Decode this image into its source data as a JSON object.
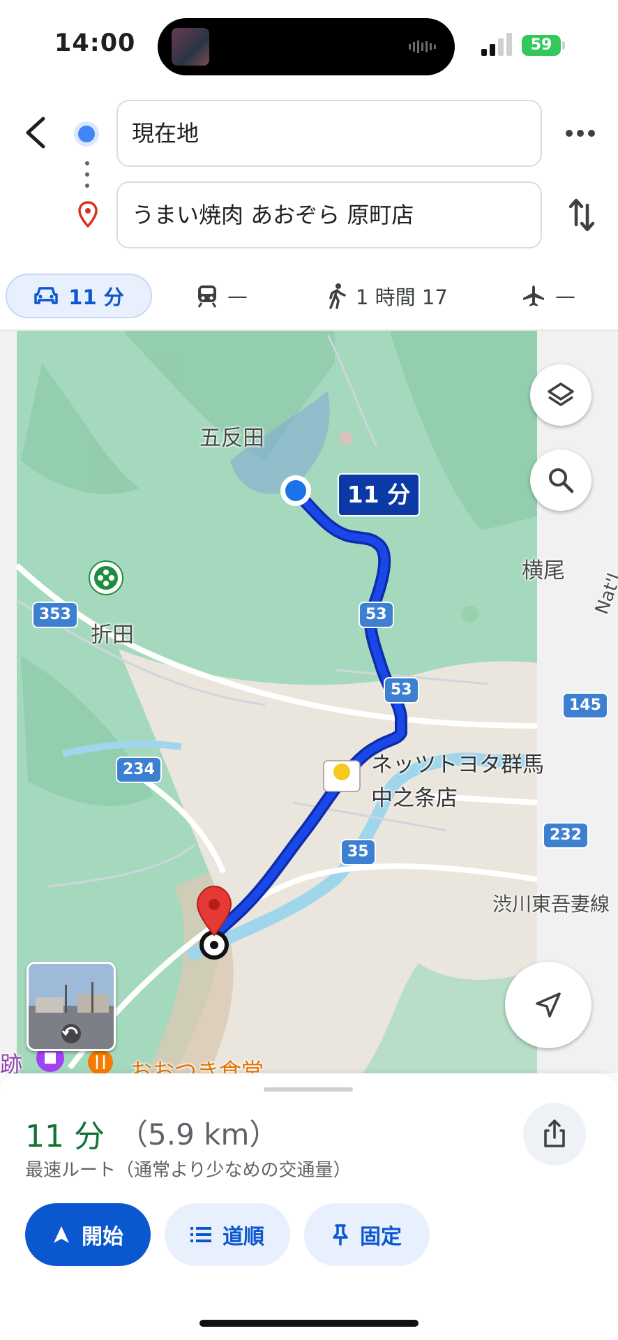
{
  "status_bar": {
    "time": "14:00",
    "battery": "59"
  },
  "route": {
    "origin": "現在地",
    "destination": "うまい焼肉 あおぞら 原町店"
  },
  "modes": {
    "car": "11 分",
    "transit": "—",
    "walk": "1 時間 17",
    "flight": "—"
  },
  "map": {
    "eta": "11 分",
    "places": {
      "gotanda": "五反田",
      "orita": "折田",
      "yokoo": "横尾",
      "nat": "Nat'l",
      "shibukawa": "渋川東吾妻線",
      "netz_line1": "ネッツトヨタ群馬",
      "netz_line2": "中之条店",
      "otsuki": "おおつき食堂",
      "ato": "跡"
    },
    "route_shields": [
      "353",
      "53",
      "53",
      "145",
      "234",
      "35",
      "232"
    ]
  },
  "summary": {
    "duration": "11 分",
    "distance": "（5.9 km）",
    "description": "最速ルート（通常より少なめの交通量）"
  },
  "actions": {
    "start": "開始",
    "steps": "道順",
    "pin": "固定"
  },
  "colors": {
    "accent": "#0b57d0",
    "route": "#1a47e8",
    "duration_green": "#137333"
  }
}
